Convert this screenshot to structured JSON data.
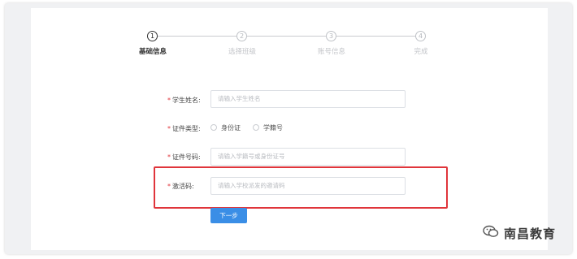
{
  "steps": [
    {
      "number": "1",
      "label": "基础信息",
      "active": true
    },
    {
      "number": "2",
      "label": "选择班级",
      "active": false
    },
    {
      "number": "3",
      "label": "账号信息",
      "active": false
    },
    {
      "number": "4",
      "label": "完成",
      "active": false
    }
  ],
  "form": {
    "required_mark": "*",
    "student_name": {
      "label": "学生姓名:",
      "placeholder": "请输入学生姓名"
    },
    "id_type": {
      "label": "证件类型:",
      "options": [
        "身份证",
        "学籍号"
      ]
    },
    "id_number": {
      "label": "证件号码:",
      "placeholder": "请输入学籍号或身份证号"
    },
    "activation_code": {
      "label": "激活码:",
      "placeholder": "请输入学校派发的邀请码"
    },
    "next_button": "下一步"
  },
  "watermark": {
    "text": "南昌教育"
  },
  "colors": {
    "primary": "#3a8ee6",
    "highlight": "#e0353b",
    "required": "#e0353b"
  }
}
